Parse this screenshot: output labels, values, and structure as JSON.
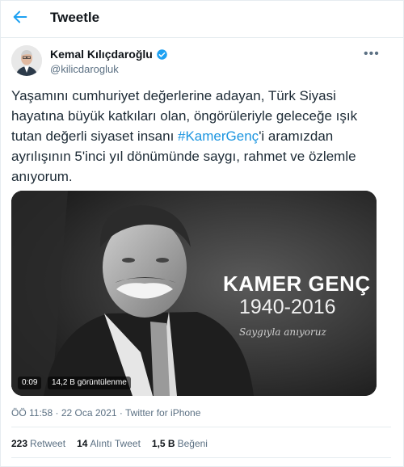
{
  "header": {
    "title": "Tweetle",
    "back_icon": "arrow-left-icon"
  },
  "author": {
    "name": "Kemal Kılıçdaroğlu",
    "handle": "@kilicdarogluk",
    "verified": true
  },
  "tweet": {
    "text_before": "Yaşamını cumhuriyet değerlerine adayan, Türk Siyasi hayatına büyük katkıları olan, öngörüleriyle geleceğe ışık tutan değerli siyaset insanı ",
    "hashtag": "#KamerGenç",
    "text_after": "'i aramızdan ayrılışının 5'inci yıl dönümünde saygı, rahmet ve özlemle anıyorum."
  },
  "media": {
    "title": "KAMER GENÇ",
    "years": "1940-2016",
    "script": "Saygıyla anıyoruz",
    "duration": "0:09",
    "views": "14,2 B görüntülenme"
  },
  "meta": {
    "time": "ÖÖ 11:58",
    "date": "22 Oca 2021",
    "source": "Twitter for iPhone",
    "separator": "·"
  },
  "stats": [
    {
      "count": "223",
      "label": "Retweet"
    },
    {
      "count": "14",
      "label": "Alıntı Tweet"
    },
    {
      "count": "1,5 B",
      "label": "Beğeni"
    }
  ],
  "colors": {
    "accent": "#1b95e0",
    "verified": "#1da1f2",
    "muted": "#5b7083"
  }
}
